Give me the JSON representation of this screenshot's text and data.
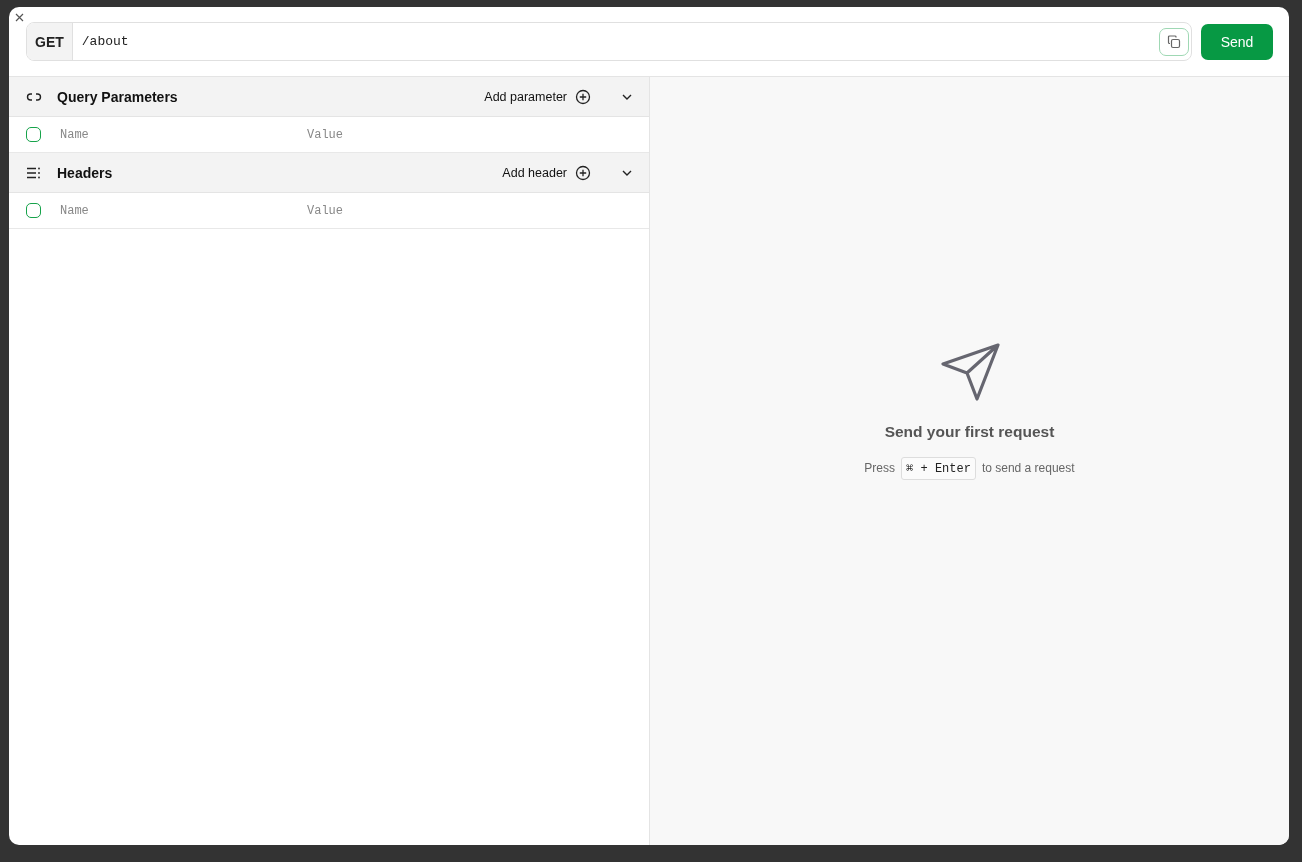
{
  "request": {
    "method": "GET",
    "url": "/about",
    "send_label": "Send"
  },
  "sections": [
    {
      "kind": "query",
      "title": "Query Parameters",
      "add_label": "Add parameter",
      "expanded": true,
      "rows": [
        {
          "checked": false,
          "name_placeholder": "Name",
          "value_placeholder": "Value"
        }
      ]
    },
    {
      "kind": "headers",
      "title": "Headers",
      "add_label": "Add header",
      "expanded": true,
      "rows": [
        {
          "checked": false,
          "name_placeholder": "Name",
          "value_placeholder": "Value"
        }
      ]
    }
  ],
  "empty_state": {
    "title": "Send your first request",
    "hint_before": "Press",
    "shortcut": "⌘ + Enter",
    "hint_after": "to send a request"
  }
}
